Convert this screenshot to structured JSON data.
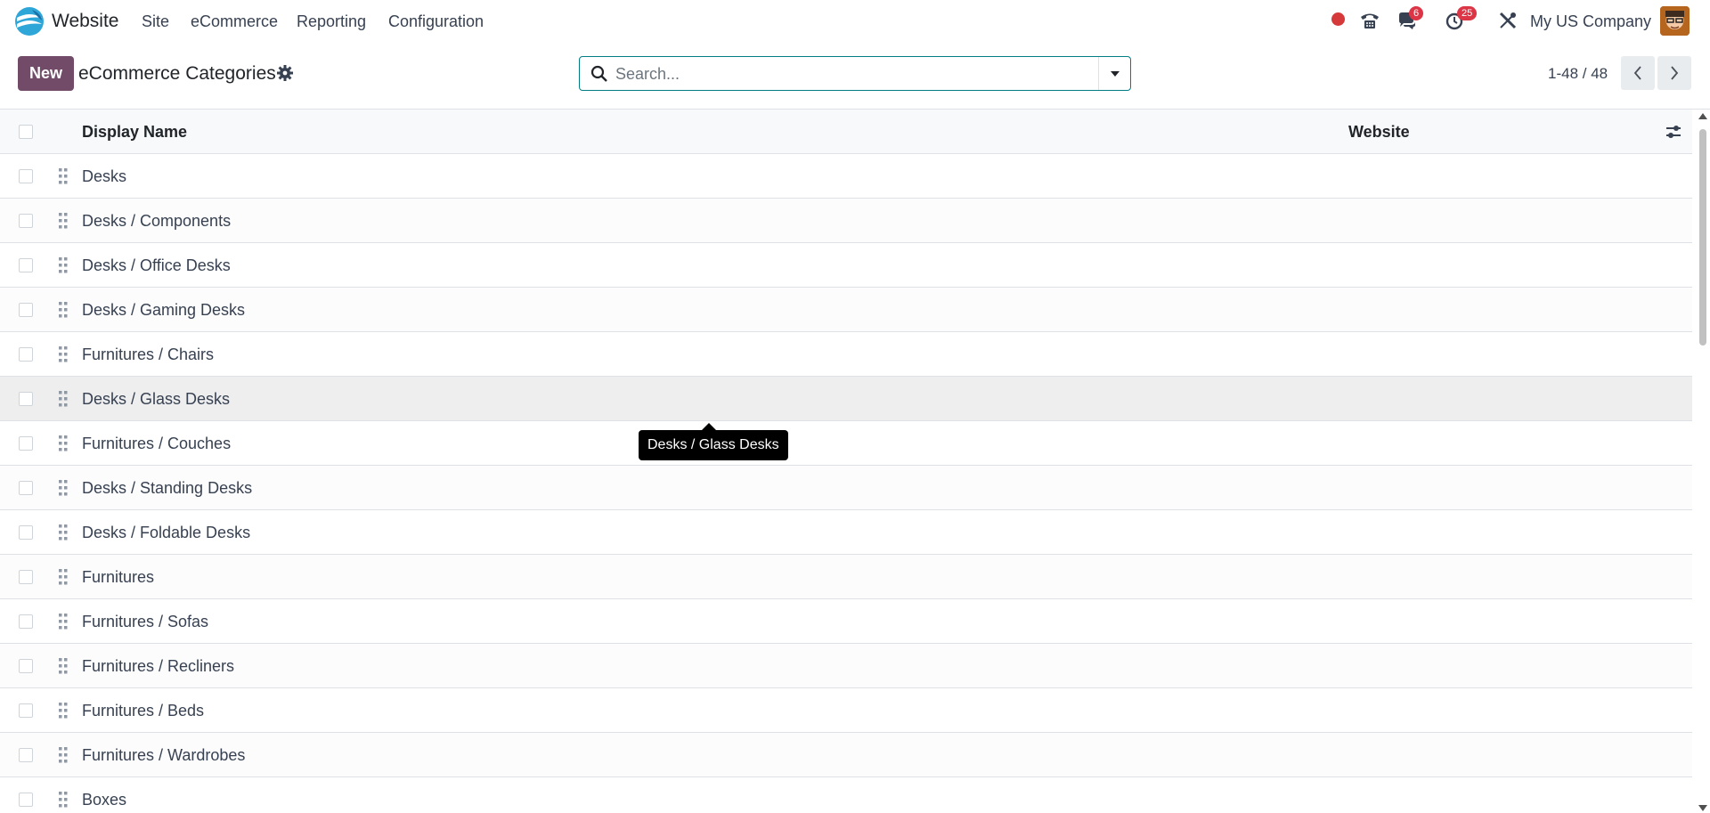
{
  "navbar": {
    "app_name": "Website",
    "menu": [
      "Site",
      "eCommerce",
      "Reporting",
      "Configuration"
    ],
    "messages_count": "6",
    "activities_count": "25",
    "company": "My US Company"
  },
  "control_panel": {
    "new_label": "New",
    "title": "eCommerce Categories",
    "search_placeholder": "Search...",
    "pager": "1-48 / 48"
  },
  "list": {
    "columns": [
      "Display Name",
      "Website"
    ],
    "rows": [
      "Desks",
      "Desks / Components",
      "Desks / Office Desks",
      "Desks / Gaming Desks",
      "Furnitures / Chairs",
      "Desks / Glass Desks",
      "Furnitures / Couches",
      "Desks / Standing Desks",
      "Desks / Foldable Desks",
      "Furnitures",
      "Furnitures / Sofas",
      "Furnitures / Recliners",
      "Furnitures / Beds",
      "Furnitures / Wardrobes",
      "Boxes"
    ],
    "hovered_row": 5
  },
  "tooltip": {
    "text": "Desks / Glass Desks"
  },
  "colors": {
    "brand": "#714b67",
    "accent": "#017e84",
    "badge": "#dc3545",
    "status_dot": "#d63939"
  },
  "icons": [
    "website-logo-icon",
    "phone-icon",
    "chat-icon",
    "clock-icon",
    "debug-tools-icon",
    "gear-icon",
    "search-icon",
    "caret-down-icon",
    "chevron-left-icon",
    "chevron-right-icon",
    "drag-handle-icon",
    "column-settings-icon"
  ]
}
